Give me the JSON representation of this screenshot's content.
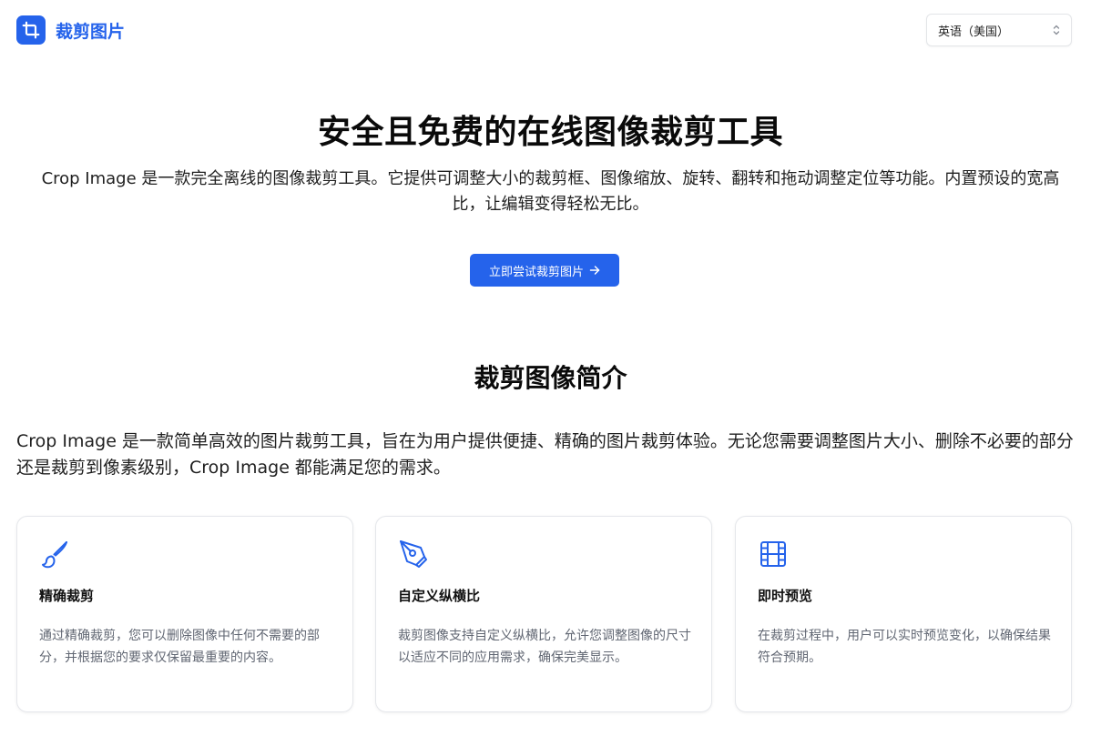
{
  "app": {
    "name": "裁剪图片"
  },
  "language": {
    "selected": "英语（美国）"
  },
  "hero": {
    "title": "安全且免费的在线图像裁剪工具",
    "description": "Crop Image 是一款完全离线的图像裁剪工具。它提供可调整大小的裁剪框、图像缩放、旋转、翻转和拖动调整定位等功能。内置预设的宽高比，让编辑变得轻松无比。",
    "cta_label": "立即尝试裁剪图片"
  },
  "intro": {
    "title": "裁剪图像简介",
    "body": "Crop Image 是一款简单高效的图片裁剪工具，旨在为用户提供便捷、精确的图片裁剪体验。无论您需要调整图片大小、删除不必要的部分还是裁剪到像素级别，Crop Image 都能满足您的需求。"
  },
  "features": [
    {
      "icon": "brush-icon",
      "title": "精确裁剪",
      "description": "通过精确裁剪，您可以删除图像中任何不需要的部分，并根据您的要求仅保留最重要的内容。"
    },
    {
      "icon": "pen-tool-icon",
      "title": "自定义纵横比",
      "description": "裁剪图像支持自定义纵横比，允许您调整图像的尺寸以适应不同的应用需求，确保完美显示。"
    },
    {
      "icon": "film-icon",
      "title": "即时预览",
      "description": "在裁剪过程中，用户可以实时预览变化，以确保结果符合预期。"
    }
  ],
  "colors": {
    "accent": "#2563eb",
    "muted_text": "#606672",
    "card_border": "#e5e7eb"
  }
}
